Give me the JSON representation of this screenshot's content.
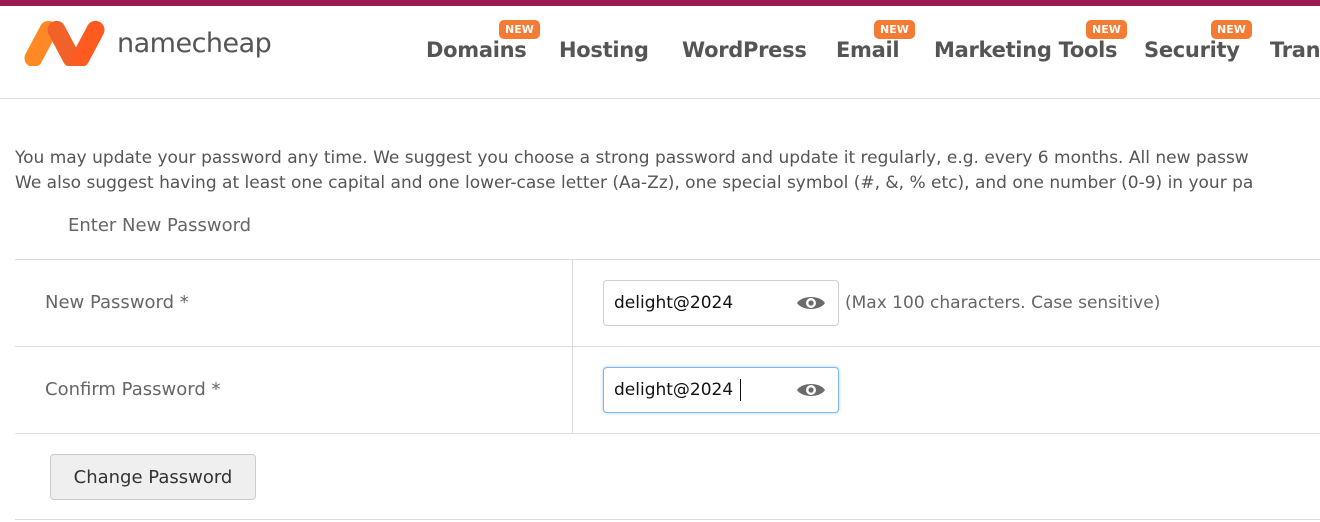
{
  "brand": {
    "name": "namecheap",
    "top_bar_color": "#9b1b52",
    "logo_colors": [
      "#ff8a25",
      "#ff5a1f"
    ]
  },
  "nav": {
    "badge_label": "NEW",
    "badge_color": "#f47b33",
    "items": [
      {
        "label": "Domains",
        "new": true
      },
      {
        "label": "Hosting",
        "new": false
      },
      {
        "label": "WordPress",
        "new": false
      },
      {
        "label": "Email",
        "new": true
      },
      {
        "label": "Marketing Tools",
        "new": true
      },
      {
        "label": "Security",
        "new": true
      },
      {
        "label": "Tran",
        "new": false
      }
    ]
  },
  "page": {
    "description_line1": "You may update your password any time. We suggest you choose a strong password and update it regularly, e.g. every 6 months. All new passw",
    "description_line2": "We also suggest having at least one capital and one lower-case letter (Aa-Zz), one special symbol (#, &, % etc), and one number (0-9) in your pa",
    "section_title": "Enter New Password"
  },
  "form": {
    "new_password": {
      "label": "New Password *",
      "value": "delight@2024",
      "hint": "(Max 100 characters. Case sensitive)",
      "eye_icon": "eye-icon"
    },
    "confirm_password": {
      "label": "Confirm Password *",
      "value": "delight@2024",
      "focused": true,
      "eye_icon": "eye-icon"
    },
    "submit_label": "Change Password"
  }
}
